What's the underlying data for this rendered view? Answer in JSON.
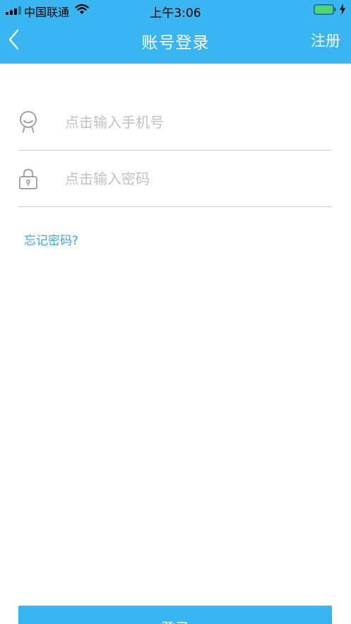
{
  "status_bar": {
    "carrier": "中国联通",
    "time": "上午3:06",
    "battery_color": "#4cd964"
  },
  "nav": {
    "title": "账号登录",
    "right_label": "注册",
    "back_icon": "chevron-left-icon",
    "background": "#39b6f1"
  },
  "form": {
    "phone": {
      "placeholder": "点击输入手机号",
      "value": "",
      "icon": "user-icon"
    },
    "password": {
      "placeholder": "点击输入密码",
      "value": "",
      "icon": "lock-icon"
    },
    "forgot_label": "忘记密码?"
  },
  "login_button": {
    "label": "登录"
  }
}
